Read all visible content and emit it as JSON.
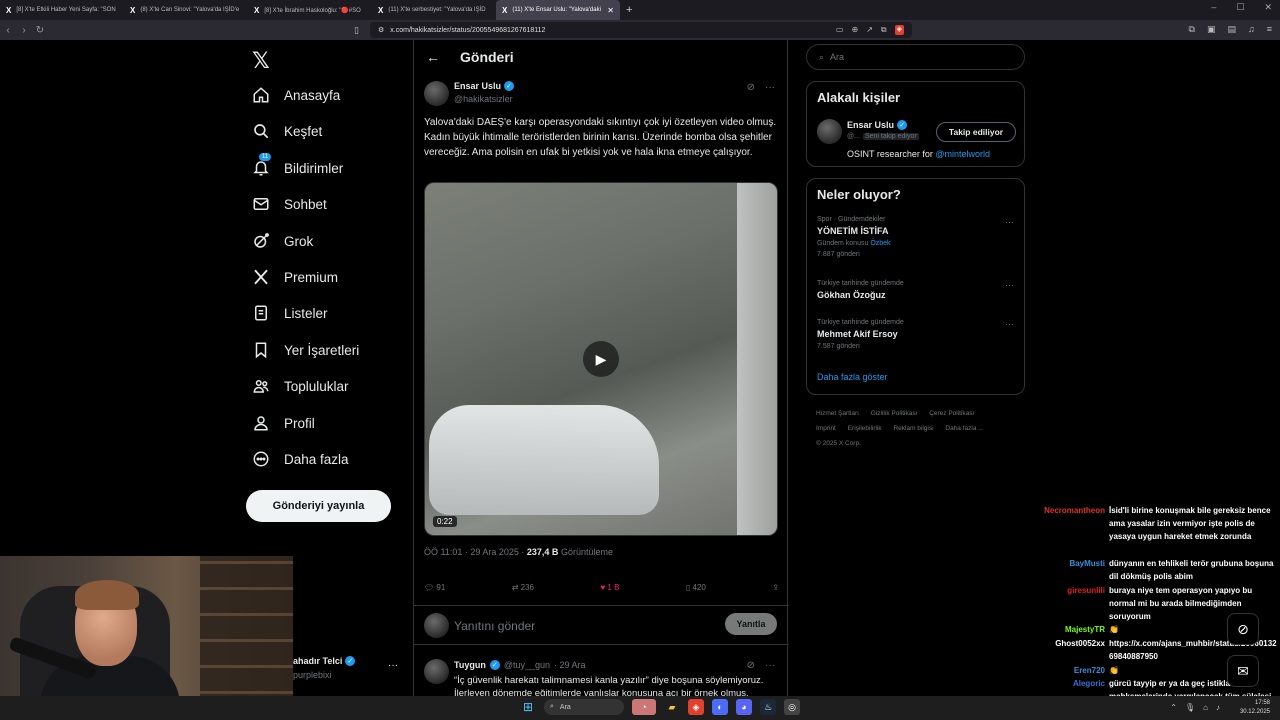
{
  "browser": {
    "tabs": [
      {
        "label": "[8] X'te Etkili Haber Yeni Sayfa: \"SON"
      },
      {
        "label": "(8) X'te Can Sinovi: \"Yalova'da IŞİD'e"
      },
      {
        "label": "[8] X'te İbrahim Haskoloğlu: \"🔴#SO"
      },
      {
        "label": "(11) X'te serbestiyet: \"Yalova'da IŞİD"
      },
      {
        "label": "(11) X'te Ensar Uslu: \"Yalova'daki"
      }
    ],
    "url": "x.com/hakikatsizler/status/2005549681267618112"
  },
  "leftnav": {
    "items": [
      {
        "label": "Anasayfa",
        "icon": "home-icon"
      },
      {
        "label": "Keşfet",
        "icon": "search-icon"
      },
      {
        "label": "Bildirimler",
        "icon": "bell-icon"
      },
      {
        "label": "Sohbet",
        "icon": "mail-icon"
      },
      {
        "label": "Grok",
        "icon": "grok-icon"
      },
      {
        "label": "Premium",
        "icon": "x-icon"
      },
      {
        "label": "Listeler",
        "icon": "list-icon"
      },
      {
        "label": "Yer İşaretleri",
        "icon": "bookmark-icon"
      },
      {
        "label": "Topluluklar",
        "icon": "people-icon"
      },
      {
        "label": "Profil",
        "icon": "user-icon"
      },
      {
        "label": "Daha fazla",
        "icon": "more-circle-icon"
      }
    ],
    "notifications_badge": "11",
    "post_button": "Gönderiyi yayınla",
    "me": {
      "name": "ahadır Telci",
      "handle": "purplebixi"
    }
  },
  "main": {
    "header": "Gönderi",
    "tweet": {
      "name": "Ensar Uslu",
      "handle": "@hakikatsizler",
      "text": "Yalova'daki DAEŞ'e karşı operasyondaki sıkıntıyı çok iyi özetleyen video olmuş. Kadın büyük ihtimalle teröristlerden birinin karısı. Üzerinde bomba olsa şehitler vereceğiz. Ama polisin en ufak bi yetkisi yok ve hala ikna etmeye çalışıyor.",
      "video_duration": "0:22",
      "time": "ÖÖ 11:01 · 29 Ara 2025 · ",
      "views": "237,4 B",
      "views_label": " Görüntüleme",
      "replies": "91",
      "retweets": "236",
      "likes": "1 B",
      "bookmarks": "420"
    },
    "reply_placeholder": "Yanıtını gönder",
    "reply_button": "Yanıtla",
    "reply2": {
      "name": "Tuygun",
      "handle": "@tuy__gun",
      "date": "· 29 Ara",
      "text": "“İç güvenlik harekatı talimnamesi kanla yazılır” diye boşuna söylemiyoruz. İlerleyen dönemde eğitimlerde vanlışlar konusuna acı bir örnek olmus."
    }
  },
  "right": {
    "search_placeholder": "Ara",
    "related": {
      "title": "Alakalı kişiler",
      "name": "Ensar Uslu",
      "handle": "@...",
      "follows_you": "Seni takip ediyor",
      "follow_button": "Takip ediliyor",
      "bio": "OSINT researcher for ",
      "bio_link": "@mintelworld"
    },
    "trends": {
      "title": "Neler oluyor?",
      "items": [
        {
          "category": "Spor · Gündemdekiler",
          "name": "YÖNETİM İSTİFA",
          "sub": "Gündem konusu ",
          "sub_link": "Özbek",
          "count": "7.887 gönderi"
        },
        {
          "category": "Türkiye tarihinde gündemde",
          "name": "Gökhan Özoğuz",
          "count": ""
        },
        {
          "category": "Türkiye tarihinde gündemde",
          "name": "Mehmet Akif Ersoy",
          "count": "7.587 gönderi"
        }
      ],
      "show_more": "Daha fazla göster"
    },
    "footer": {
      "links": [
        "Hizmet Şartları",
        "Gizlilik Politikası",
        "Çerez Politikası",
        "Imprint",
        "Erişilebilirlik",
        "Reklam bilgisi",
        "Daha fazla ..."
      ],
      "copyright": "© 2025 X Corp."
    }
  },
  "chat": [
    {
      "user": "Necromantheon",
      "color": "#e0302e",
      "text": "İsid'li birine konuşmak bile gereksiz bence ama yasalar izin vermiyor işte polis de yasaya uygun hareket etmek zorunda"
    },
    {
      "user": "BayMusti",
      "color": "#3a8fd8",
      "text": "dünyanın en tehlikeli terör grubuna boşuna dil dökmüş polis abim"
    },
    {
      "user": "giresunlili",
      "color": "#e02020",
      "text": "buraya niye tem operasyon yapıyo bu normal mi bu arada bilmediğimden soruyorum"
    },
    {
      "user": "MajestyTR",
      "color": "#7cfc00",
      "text": "👏"
    },
    {
      "user": "Ghost0052xx",
      "color": "#ffffff",
      "text": "https://x.com/ajans_muhbir/status/2006013269840887950"
    },
    {
      "user": "Eren720",
      "color": "#3a8fd8",
      "text": "👏"
    },
    {
      "user": "Alegoric",
      "color": "#3a6fd8",
      "text": "gürcü tayyip er ya da geç istiklal mahkemelerinde yargılanacak tüm sülalesi ile birlikte"
    }
  ],
  "taskbar": {
    "search": "Ara",
    "time": "17:58",
    "date": "30.12.2025"
  }
}
